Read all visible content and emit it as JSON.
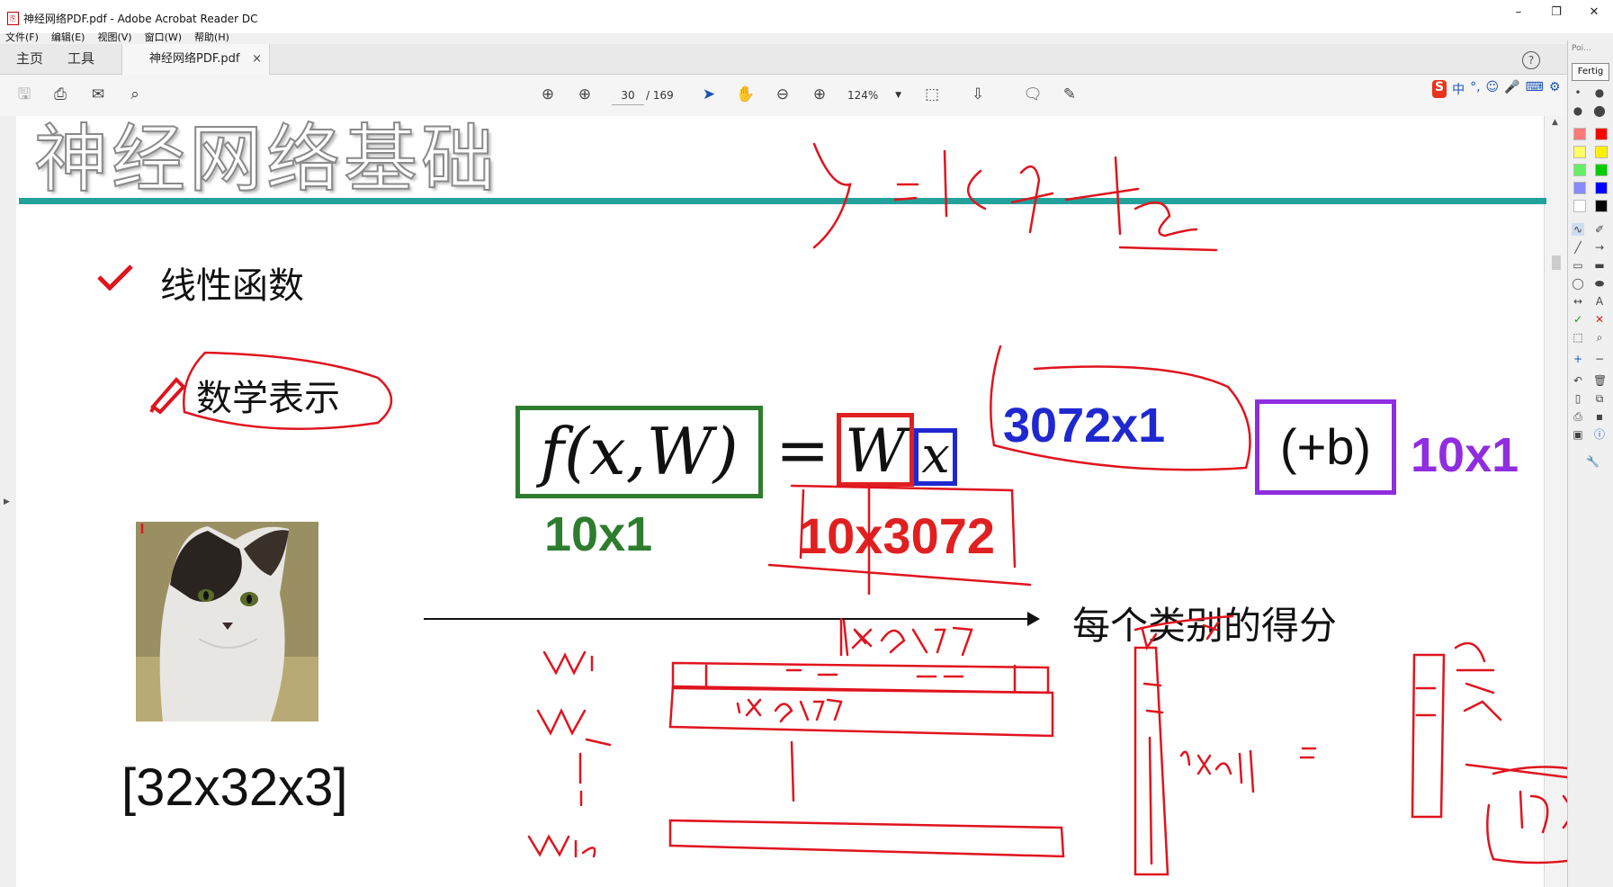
{
  "window": {
    "title": "神经网络PDF.pdf - Adobe Acrobat Reader DC",
    "minimize": "–",
    "restore": "❐",
    "close": "✕"
  },
  "menu": [
    "文件(F)",
    "编辑(E)",
    "视图(V)",
    "窗口(W)",
    "帮助(H)"
  ],
  "tabs": {
    "home": "主页",
    "tools": "工具",
    "document": "神经网络PDF.pdf",
    "close": "×",
    "help": "?"
  },
  "toolbar": {
    "page_current": "30",
    "page_total": "/ 169",
    "zoom": "124%"
  },
  "ime": {
    "logo": "S",
    "items": [
      "中",
      "°,",
      "☺",
      "🎤",
      "⌨",
      "⚙"
    ]
  },
  "palette": {
    "header": "Poi...",
    "done": "Fertig",
    "colors": [
      "#ff7a7a",
      "#ff0000",
      "#ffff66",
      "#ffee00",
      "#66ee66",
      "#00cc00",
      "#8888ff",
      "#0000ff",
      "#ffffff",
      "#000000"
    ]
  },
  "slide": {
    "title": "神经网络基础",
    "bullet1": "线性函数",
    "bullet2": "数学表示",
    "formula_lhs": "f(x,W)",
    "equals": "=",
    "w": "W",
    "x": "x",
    "bias": "(+b)",
    "dim_lhs": "10x1",
    "dim_w": "10x3072",
    "dim_x": "3072x1",
    "dim_b": "10x1",
    "image_dims": "[32x32x3]",
    "score_label": "每个类别的得分"
  },
  "colors": {
    "green": "#2e7d2e",
    "red": "#e02020",
    "blue": "#1f28d0",
    "purple": "#8f2de0",
    "ink": "#e0141e",
    "teal": "#23a19b"
  }
}
